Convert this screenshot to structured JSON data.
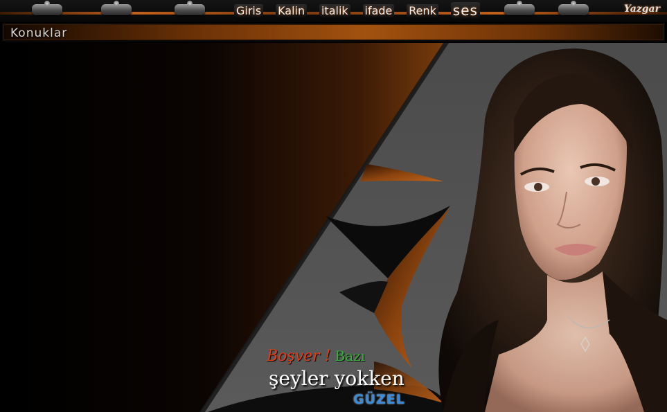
{
  "toolbar": {
    "menu": [
      "Giris",
      "Kalin",
      "italik",
      "ifade",
      "Renk",
      "ses"
    ],
    "logo": "Yazgar"
  },
  "guests": {
    "title": "Konuklar"
  },
  "poster": {
    "line1_a": "Boşver !",
    "line1_b": "Bazı",
    "line2": "şeyler yokken",
    "line3": "GÜZEL"
  },
  "colors": {
    "accent": "#c1601c",
    "panel_gray": "#4d4d4d",
    "caption_red": "#e33d12",
    "caption_green": "#37b13a",
    "caption_blue": "#3b8ad6"
  }
}
